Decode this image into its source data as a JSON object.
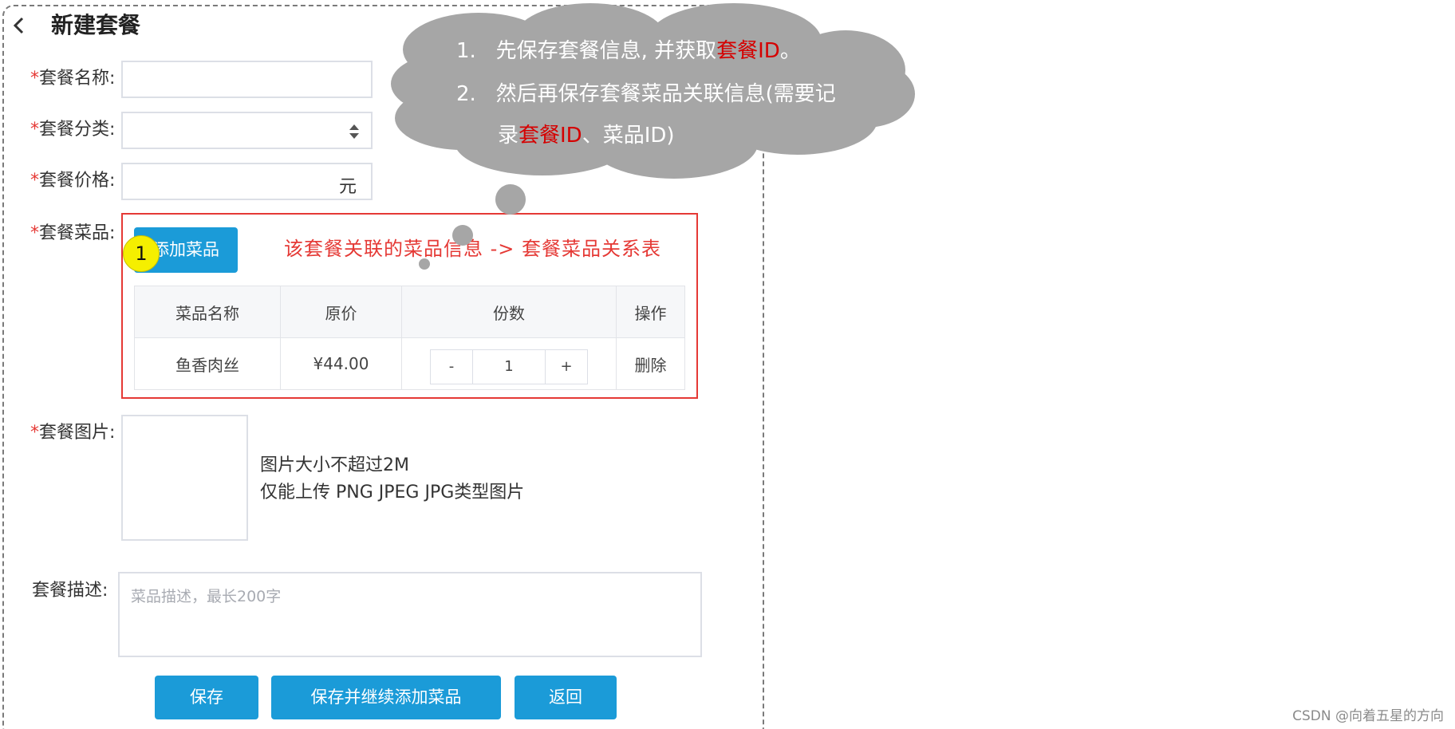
{
  "page": {
    "title": "新建套餐"
  },
  "form": {
    "name_label": "套餐名称:",
    "category_label": "套餐分类:",
    "price_label": "套餐价格:",
    "price_unit": "元",
    "dishes_label": "套餐菜品:",
    "image_label": "套餐图片:",
    "desc_label": "套餐描述:",
    "desc_placeholder": "菜品描述，最长200字",
    "required_mark": "*"
  },
  "dishes": {
    "add_button": "添加菜品",
    "step_badge": "1",
    "relation_note": "该套餐关联的菜品信息  ->  套餐菜品关系表",
    "columns": [
      "菜品名称",
      "原价",
      "份数",
      "操作"
    ],
    "rows": [
      {
        "name": "鱼香肉丝",
        "price": "¥44.00",
        "minus": "-",
        "qty": "1",
        "plus": "+",
        "action": "删除"
      }
    ]
  },
  "upload": {
    "hint_line1": "图片大小不超过2M",
    "hint_line2": "仅能上传 PNG JPEG JPG类型图片"
  },
  "buttons": {
    "save": "保存",
    "save_continue": "保存并继续添加菜品",
    "back": "返回"
  },
  "callout": {
    "item1_num": "1.",
    "item1_pre": "先保存套餐信息, 并获取",
    "item1_hl": "套餐ID",
    "item1_post": "。",
    "item2_num": "2.",
    "item2_line1": "然后再保存套餐菜品关联信息(需要记",
    "item2_pre": "录",
    "item2_hl": "套餐ID",
    "item2_post": "、菜品ID)",
    "fill_color": "#a6a6a6",
    "highlight_color": "#d50000"
  },
  "watermark": "CSDN @向着五星的方向",
  "colors": {
    "primary": "#1b9bd8",
    "annotation_red": "#e53935",
    "badge_yellow": "#f5ef00"
  }
}
